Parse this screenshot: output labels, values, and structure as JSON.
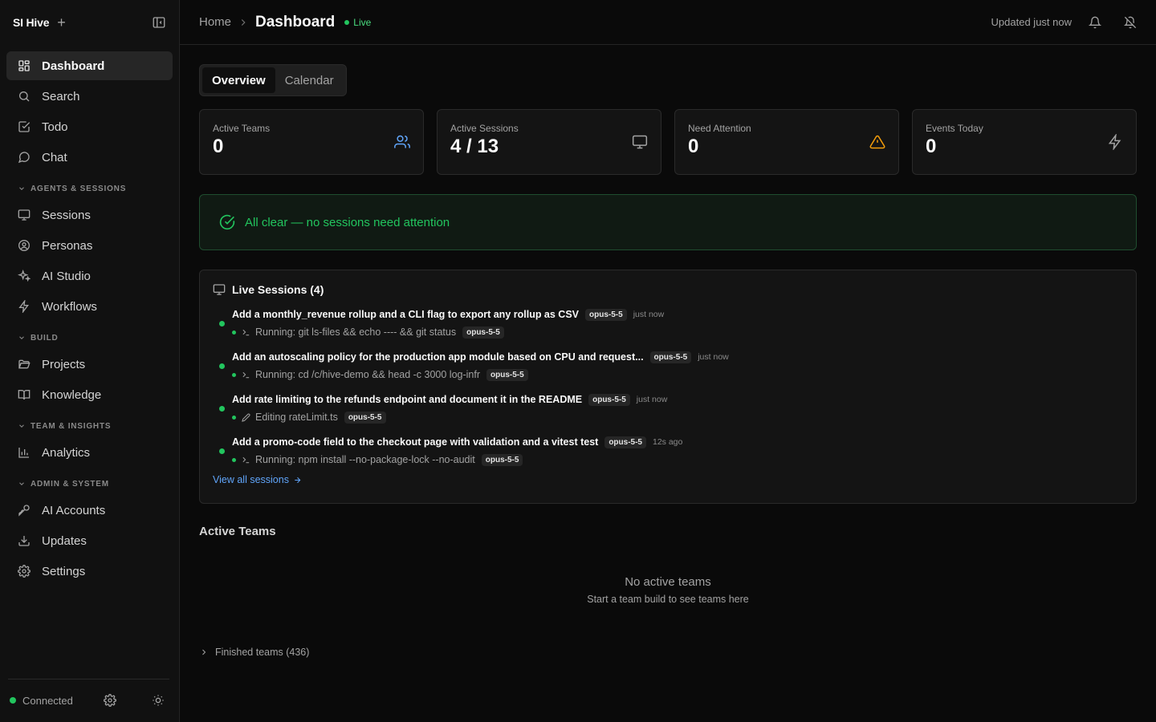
{
  "sidebar": {
    "brand": "SI Hive",
    "items_top": [
      {
        "label": "Dashboard",
        "icon": "dashboard-icon",
        "active": true
      },
      {
        "label": "Search",
        "icon": "search-icon"
      },
      {
        "label": "Todo",
        "icon": "todo-icon"
      },
      {
        "label": "Chat",
        "icon": "chat-icon"
      }
    ],
    "sections": {
      "agents": "AGENTS & SESSIONS",
      "build": "BUILD",
      "team": "TEAM & INSIGHTS",
      "admin": "ADMIN & SYSTEM"
    },
    "items": {
      "sessions": "Sessions",
      "personas": "Personas",
      "ai_studio": "AI Studio",
      "workflows": "Workflows",
      "projects": "Projects",
      "knowledge": "Knowledge",
      "analytics": "Analytics",
      "ai_accounts": "AI Accounts",
      "updates": "Updates",
      "settings": "Settings"
    },
    "footer": {
      "status": "Connected",
      "status_color": "#22c55e"
    }
  },
  "topbar": {
    "home": "Home",
    "current": "Dashboard",
    "live": "Live",
    "updated": "Updated just now"
  },
  "tabs": [
    "Overview",
    "Calendar"
  ],
  "stats": [
    {
      "label": "Active Teams",
      "value": "0",
      "icon": "users-icon",
      "color": "#60a5fa"
    },
    {
      "label": "Active Sessions",
      "value": "4 / 13",
      "icon": "monitor-icon",
      "color": "#a3a3a3"
    },
    {
      "label": "Need Attention",
      "value": "0",
      "icon": "warning-icon",
      "color": "#f59e0b"
    },
    {
      "label": "Events Today",
      "value": "0",
      "icon": "zap-icon",
      "color": "#a3a3a3"
    }
  ],
  "all_clear": "All clear — no sessions need attention",
  "live_sessions": {
    "title": "Live Sessions (4)",
    "items": [
      {
        "title": "Add a monthly_revenue rollup and a CLI flag to export any rollup as CSV",
        "model": "opus-5-5",
        "time": "just now",
        "activity": "Running: git ls-files && echo ---- && git status",
        "activity_icon": "terminal-icon",
        "activity_model": "opus-5-5"
      },
      {
        "title": "Add an autoscaling policy for the production app module based on CPU and request...",
        "model": "opus-5-5",
        "time": "just now",
        "activity": "Running: cd /c/hive-demo && head -c 3000 log-infr",
        "activity_icon": "terminal-icon",
        "activity_model": "opus-5-5"
      },
      {
        "title": "Add rate limiting to the refunds endpoint and document it in the README",
        "model": "opus-5-5",
        "time": "just now",
        "activity": "Editing rateLimit.ts",
        "activity_icon": "pencil-icon",
        "activity_model": "opus-5-5"
      },
      {
        "title": "Add a promo-code field to the checkout page with validation and a vitest test",
        "model": "opus-5-5",
        "time": "12s ago",
        "activity": "Running: npm install --no-package-lock --no-audit",
        "activity_icon": "terminal-icon",
        "activity_model": "opus-5-5"
      }
    ],
    "view_all": "View all sessions"
  },
  "active_teams": {
    "title": "Active Teams",
    "empty_title": "No active teams",
    "empty_sub": "Start a team build to see teams here",
    "finished": "Finished teams (436)"
  }
}
